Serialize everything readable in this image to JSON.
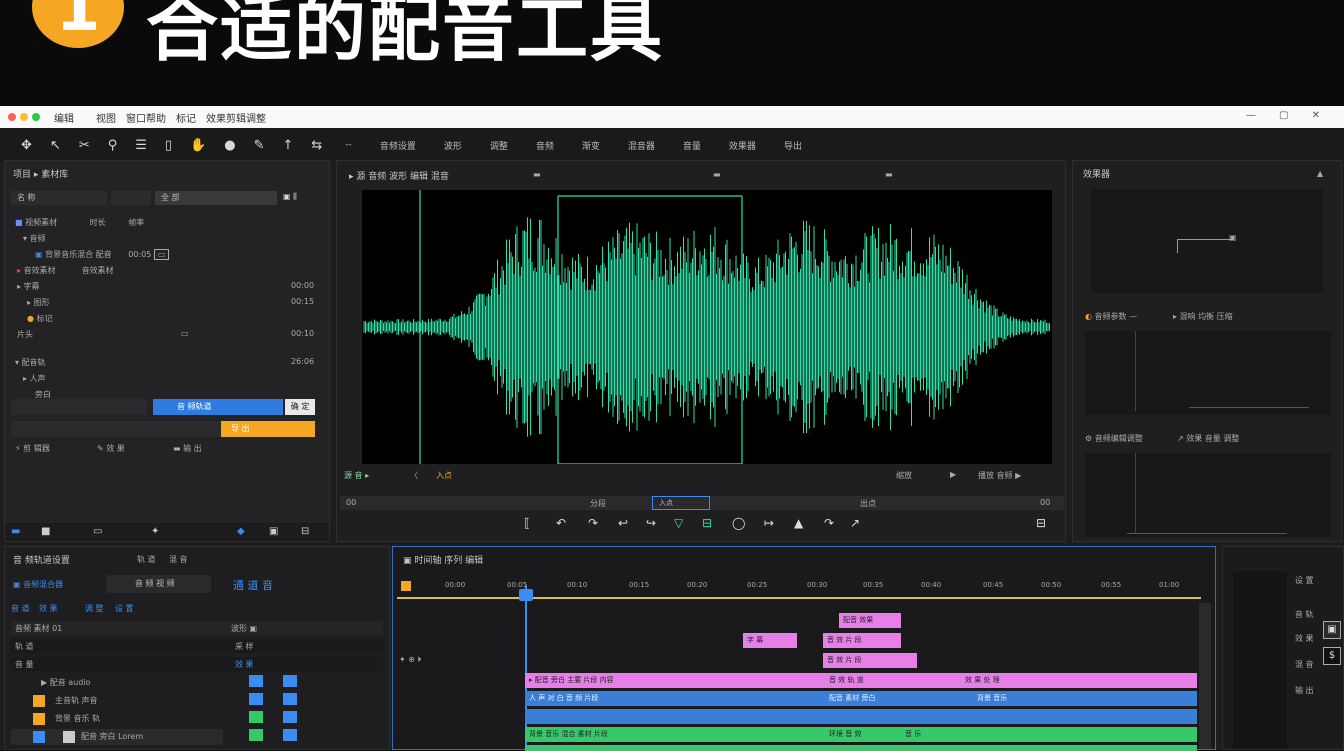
{
  "banner": {
    "badge": "1",
    "headline": "合适的配音工具"
  },
  "titlebar": {
    "menus": [
      "编辑",
      "视图",
      "窗口帮助",
      "标记",
      "效果剪辑调整"
    ],
    "win_controls": "— ▢ ✕"
  },
  "toolbar": {
    "icons": [
      "move-icon",
      "select-icon",
      "razor-icon",
      "zoom-icon",
      "text-icon",
      "shape-icon",
      "hand-icon",
      "effects-icon",
      "pen-icon",
      "arrow-icon",
      "slip-icon"
    ],
    "labels": [
      "--",
      "音频设置",
      "波形",
      "调整",
      "音频",
      "渐变",
      "混音器",
      "音量",
      "效果器",
      "导出"
    ]
  },
  "left_panel": {
    "title": "项目 ▸ 素材库",
    "search_left": "名 称",
    "search_right": "全 部",
    "rows": [
      {
        "a": "视频素材",
        "b": "时长",
        "c": "帧率"
      },
      {
        "a": "▾ 音频",
        "b": "",
        "c": ""
      },
      {
        "a": "背景音乐混合 配音",
        "b": "00:05",
        "c": ""
      },
      {
        "a": "音效素材",
        "b": "音效素材",
        "c": ""
      },
      {
        "a": "▸ 字幕",
        "b": "",
        "c": "00:00"
      },
      {
        "a": "▸ 图形",
        "b": "",
        "c": "00:15"
      },
      {
        "a": "标记",
        "b": "",
        "c": ""
      },
      {
        "a": "片头",
        "b": "",
        "c": "00:10"
      },
      {
        "a": "▾ 配音轨",
        "b": "",
        "c": "26:06"
      },
      {
        "a": "▸ 人声",
        "b": "",
        "c": ""
      },
      {
        "a": "旁白",
        "b": "",
        "c": ""
      }
    ],
    "blue_button": "音 频轨道",
    "white_button": "确 定",
    "orange_button": "导 出",
    "footer": [
      "剪 辑器",
      "效 果",
      "输 出"
    ]
  },
  "source_panel": {
    "title": "▸ 源 音频 波形 编辑 混音",
    "left_label": "源 音 ▸",
    "tools": [
      "〈",
      "入点"
    ],
    "right_tools": [
      "缩放",
      "▶",
      "播放 音频 ▶"
    ],
    "scrub_labels": [
      "00",
      "分段",
      "入点",
      "出点",
      "00"
    ]
  },
  "transport": {
    "buttons": [
      "⟦",
      "↶",
      "↷",
      "↩",
      "↪",
      "▽",
      "⊟",
      "◯",
      "↦",
      "▲",
      "↷",
      "↗",
      "⊟"
    ]
  },
  "right_panel": {
    "title": "效果器",
    "section2": "音频参数 —",
    "section2b": "混响 均衡 压缩",
    "section3": "音频编辑调整",
    "section3b": "效果 音量 调整"
  },
  "bottom_left": {
    "title": "音 频轨道设置",
    "tabs": [
      "轨 道",
      "混 音"
    ],
    "top_row": [
      "▣ 音频混合器",
      "音 频 视 频",
      "通 道 音"
    ],
    "chips": [
      "音 道",
      "效 果",
      "调 整",
      "设 置"
    ],
    "rows": [
      {
        "a": "音频 素材 01",
        "b": "波形 ▣"
      },
      {
        "a": "轨 道",
        "b": "采 样"
      },
      {
        "a": "音 量",
        "b": "效 果"
      },
      {
        "a": "▶ 配音 audio",
        "b": ""
      },
      {
        "a": "主音轨 声音",
        "b": ""
      },
      {
        "a": "背景 音乐 轨",
        "b": ""
      },
      {
        "a": "配音 旁白 Lorem",
        "b": ""
      }
    ]
  },
  "timeline": {
    "title": "时间轴 序列 编辑",
    "ticks": [
      "00:00",
      "00:05",
      "00:10",
      "00:15",
      "00:20",
      "00:25",
      "00:30",
      "00:35",
      "00:40",
      "00:45",
      "00:50",
      "00:55",
      "01:00"
    ],
    "clips": {
      "pink1": "配音 效果",
      "pink2": "字 幕",
      "pink3": "音 效 片 段",
      "pink_wide": "▸ 配音 旁白 主要 片段 内容",
      "pink_wide2": "音 效 轨 道",
      "pink_wide3": "效 果 处 理",
      "blue1": "人 声 对 白 音 频 片段",
      "blue2": "配音 素材 旁白",
      "blue3": "背景 音乐",
      "green1": "背景 音乐 混合 素材 片段",
      "green2": "环境 音 效",
      "green3": "音 乐"
    }
  },
  "right_strip": {
    "labels": [
      "设 置",
      "音 轨",
      "效 果",
      "混 音",
      "输 出"
    ]
  },
  "colors": {
    "wave": "#2fe0a8",
    "accent_blue": "#2f7be0",
    "orange": "#f5a623",
    "pink": "#e77fe8",
    "clip_blue": "#3a7ed8",
    "clip_green": "#36c96a"
  }
}
